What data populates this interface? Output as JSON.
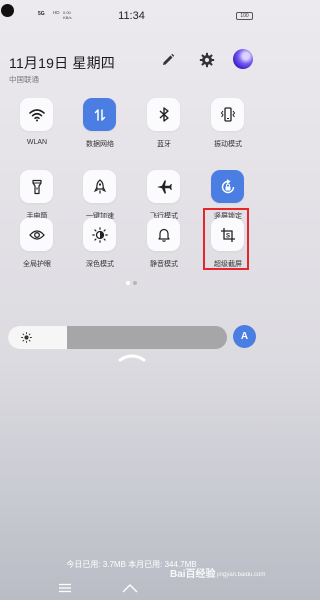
{
  "status_bar": {
    "network": "5G",
    "network_sub": "HD",
    "speed": "0.00\nKB/s",
    "time": "11:34",
    "battery": "100"
  },
  "header": {
    "date": "11月19日 星期四",
    "carrier": "中国联通"
  },
  "tiles": [
    {
      "label": "WLAN",
      "icon": "wifi-icon",
      "active": false
    },
    {
      "label": "数据网络",
      "icon": "mobile-data-icon",
      "active": true
    },
    {
      "label": "蓝牙",
      "icon": "bluetooth-icon",
      "active": false
    },
    {
      "label": "振动模式",
      "icon": "vibrate-icon",
      "active": false
    },
    {
      "label": "手电筒",
      "icon": "flashlight-icon",
      "active": false
    },
    {
      "label": "一键加速",
      "icon": "rocket-icon",
      "active": false
    },
    {
      "label": "飞行模式",
      "icon": "airplane-icon",
      "active": false
    },
    {
      "label": "竖屏锁定",
      "icon": "rotation-lock-icon",
      "active": true
    },
    {
      "label": "全局护眼",
      "icon": "eye-icon",
      "active": false
    },
    {
      "label": "深色模式",
      "icon": "dark-mode-icon",
      "active": false
    },
    {
      "label": "静音模式",
      "icon": "bell-icon",
      "active": false
    },
    {
      "label": "超级截屏",
      "icon": "screenshot-icon",
      "active": false
    }
  ],
  "brightness": {
    "level": 0.27,
    "auto_label": "A"
  },
  "data_usage": "今日已用: 3.7MB 本月已用: 344.7MB",
  "watermark": "Bai百经验",
  "watermark_sub": "jingyan.baidu.com",
  "colors": {
    "accent": "#4a7ee3",
    "highlight": "#e5262c"
  }
}
